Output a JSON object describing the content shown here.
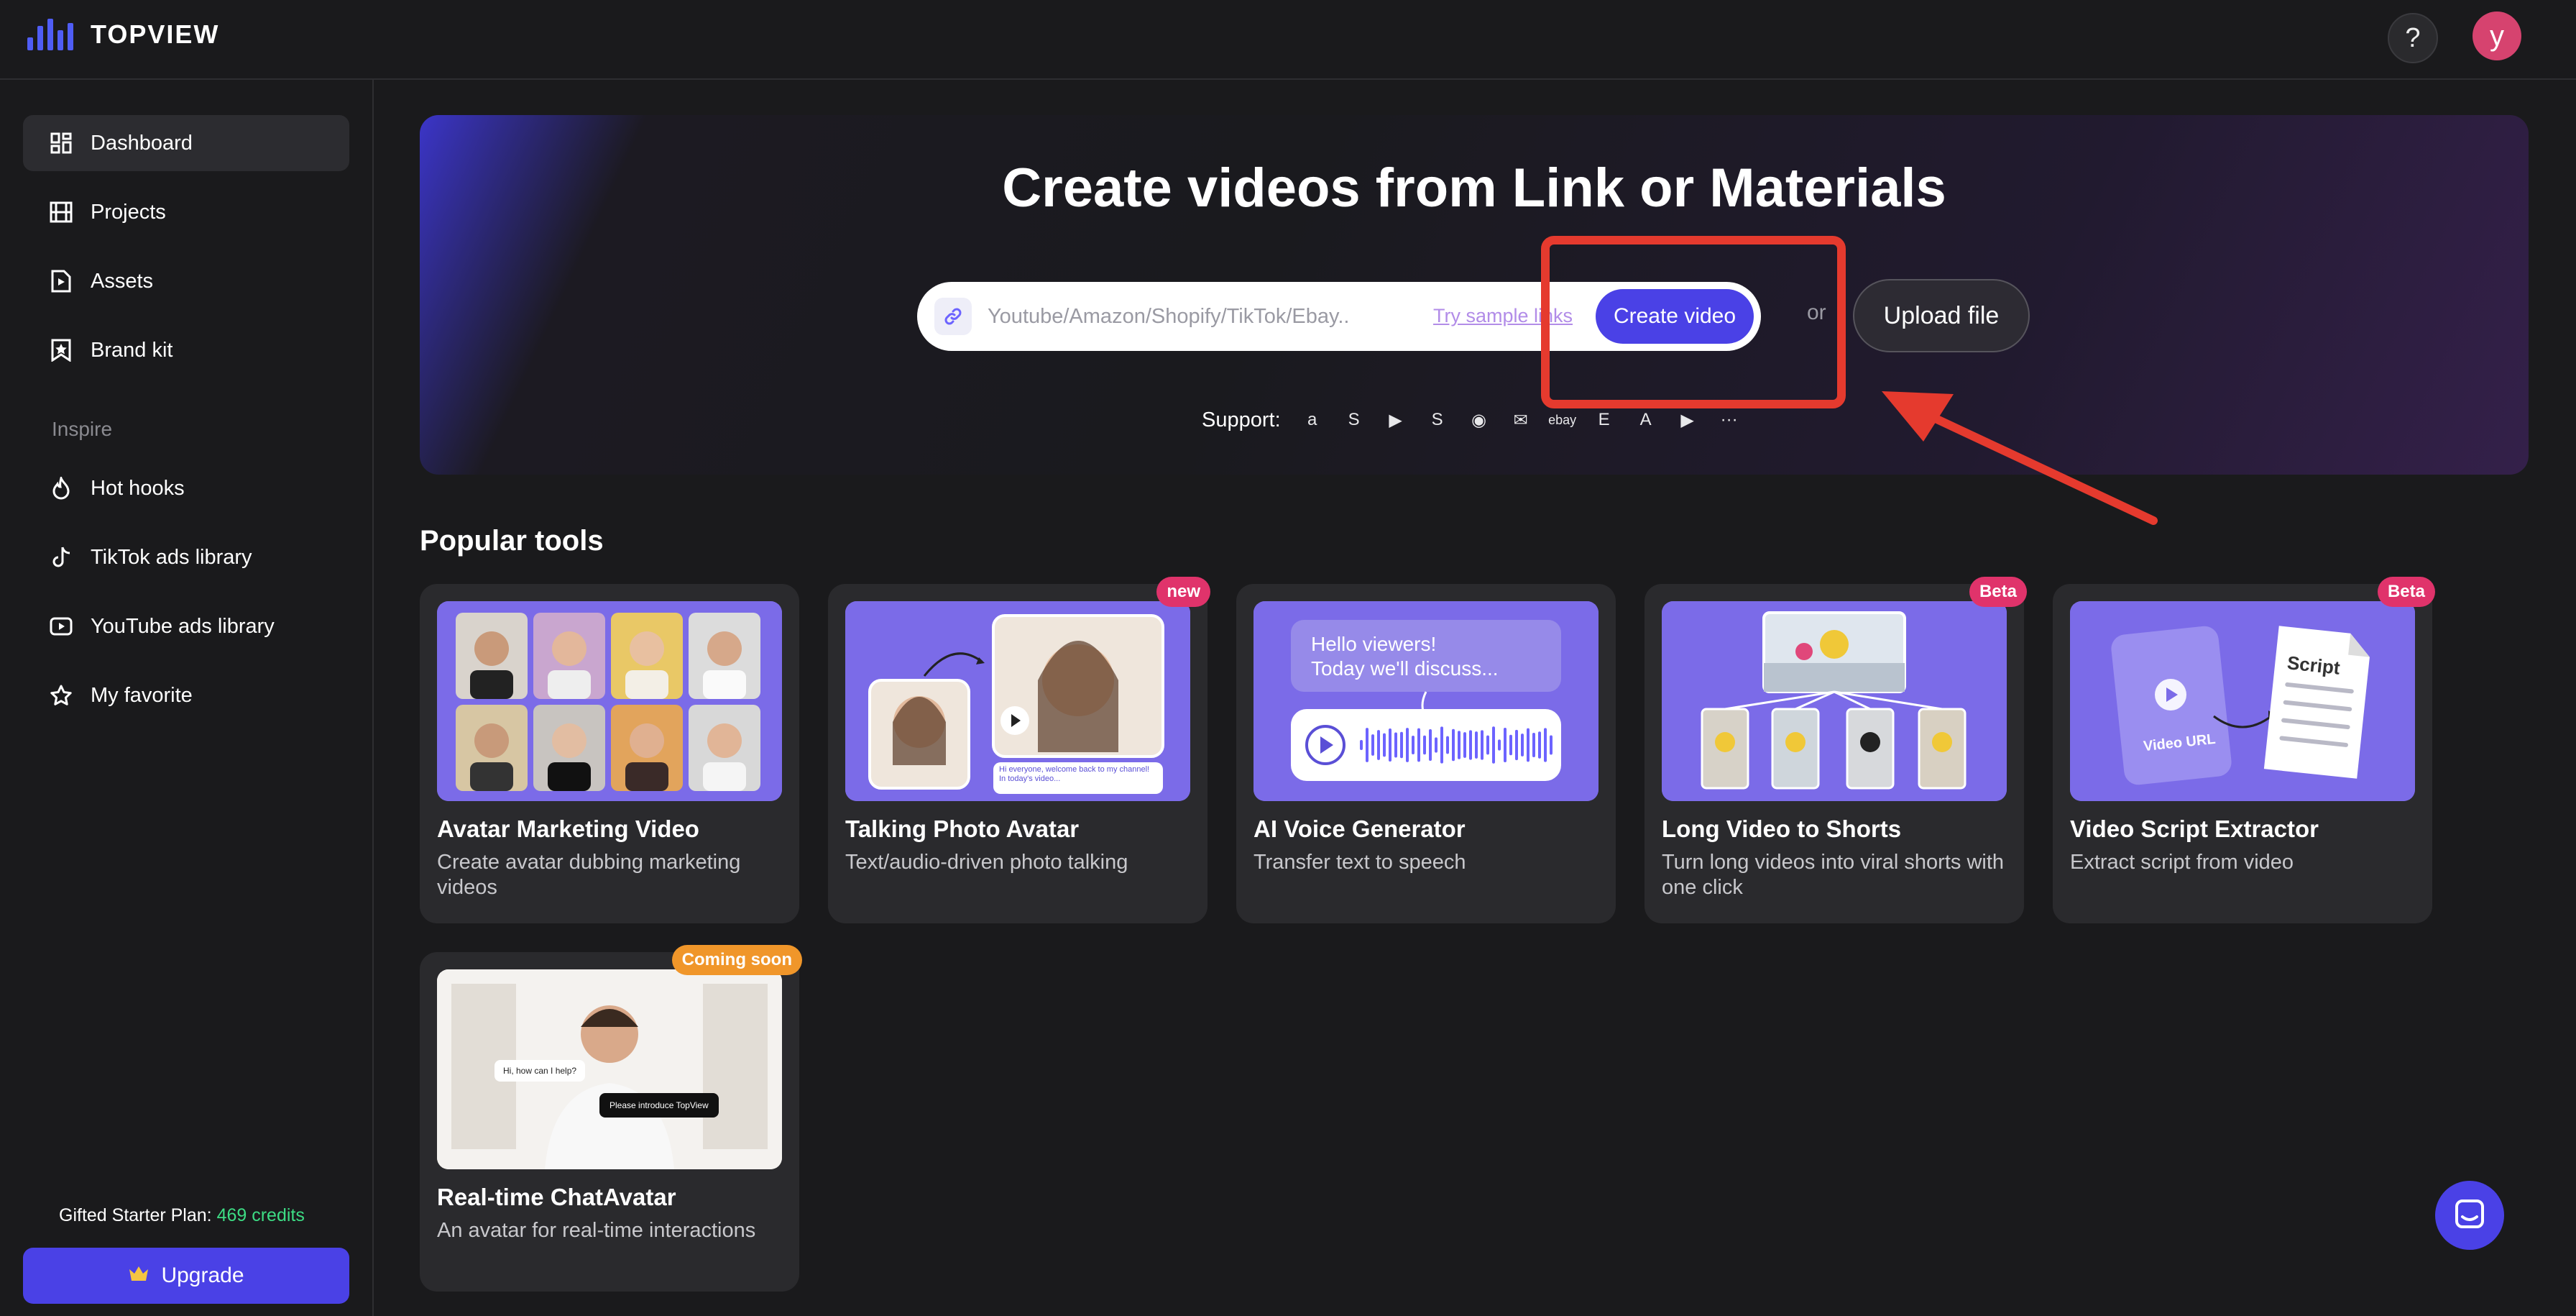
{
  "app": {
    "name": "TOPVIEW"
  },
  "header": {
    "help_label": "?",
    "avatar_initial": "y"
  },
  "sidebar": {
    "items": [
      {
        "label": "Dashboard",
        "icon": "dashboard-icon"
      },
      {
        "label": "Projects",
        "icon": "film-icon"
      },
      {
        "label": "Assets",
        "icon": "file-play-icon"
      },
      {
        "label": "Brand kit",
        "icon": "bookmark-star-icon"
      }
    ],
    "section_label": "Inspire",
    "inspire_items": [
      {
        "label": "Hot hooks",
        "icon": "flame-icon"
      },
      {
        "label": "TikTok ads library",
        "icon": "tiktok-icon"
      },
      {
        "label": "YouTube ads library",
        "icon": "youtube-icon"
      },
      {
        "label": "My favorite",
        "icon": "star-icon"
      }
    ],
    "plan_label": "Gifted Starter Plan:",
    "credits": "469 credits",
    "upgrade_label": "Upgrade"
  },
  "hero": {
    "title": "Create videos from Link or Materials",
    "link_placeholder": "Youtube/Amazon/Shopify/TikTok/Ebay..",
    "sample_link": "Try sample links",
    "create_label": "Create video",
    "or_label": "or",
    "upload_label": "Upload file",
    "support_label": "Support:",
    "platforms": [
      "a",
      "S",
      "▶",
      "S",
      "◉",
      "✉",
      "ebay",
      "E",
      "A",
      "▶",
      "···"
    ]
  },
  "popular": {
    "title": "Popular tools",
    "tools": [
      {
        "title": "Avatar Marketing Video",
        "desc": "Create avatar dubbing marketing videos",
        "badge": ""
      },
      {
        "title": "Talking Photo Avatar",
        "desc": "Text/audio-driven photo talking",
        "badge": "new"
      },
      {
        "title": "AI Voice Generator",
        "desc": "Transfer text to speech",
        "badge": ""
      },
      {
        "title": "Long Video to Shorts",
        "desc": "Turn long videos into viral shorts with one click",
        "badge": "Beta"
      },
      {
        "title": "Video Script Extractor",
        "desc": "Extract script from video",
        "badge": "Beta"
      },
      {
        "title": "Real-time ChatAvatar",
        "desc": "An avatar for real-time interactions",
        "badge": "Coming soon"
      }
    ]
  },
  "thumbs": {
    "talking_caption": "Hi everyone, welcome back to my channel! In today's video...",
    "voice_text_1": "Hello viewers!",
    "voice_text_2": "Today we'll discuss...",
    "script_label": "Script",
    "video_url_label": "Video URL",
    "chat_bubble_1": "Hi, how can I help?",
    "chat_bubble_2": "Please introduce TopView"
  },
  "colors": {
    "accent": "#4a41e6",
    "annotation": "#e53a2e",
    "credits": "#3ddc84"
  }
}
